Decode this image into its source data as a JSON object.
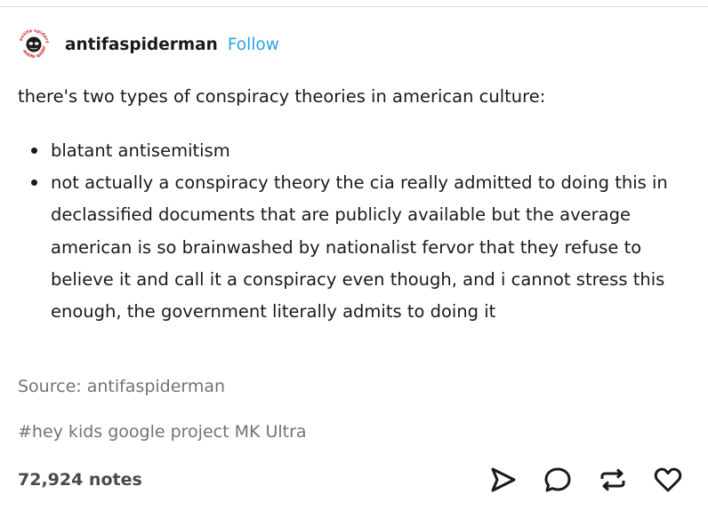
{
  "post": {
    "author": "antifaspiderman",
    "follow_label": "Follow",
    "avatar_icon": "spider-skull-avatar-icon",
    "avatar_seal_text": "antifa spiders",
    "body_intro": "there's two types of conspiracy theories in american culture:",
    "list_items": [
      "blatant antisemitism",
      "not actually a conspiracy theory the cia really admitted to doing this in declassified documents that are publicly available but the average american is so brainwashed by nationalist fervor that they refuse to believe it and call it a conspiracy even though, and i cannot stress this enough, the government literally admits to doing it"
    ],
    "source": "Source: antifaspiderman",
    "tag": "#hey kids google project MK Ultra",
    "notes": "72,924 notes"
  },
  "actions": {
    "share_icon": "send-icon",
    "reply_icon": "reply-bubble-icon",
    "reblog_icon": "reblog-icon",
    "like_icon": "heart-icon"
  },
  "colors": {
    "follow": "#29a4e6",
    "muted_text": "#737373",
    "avatar_accent": "#d92a2a"
  }
}
